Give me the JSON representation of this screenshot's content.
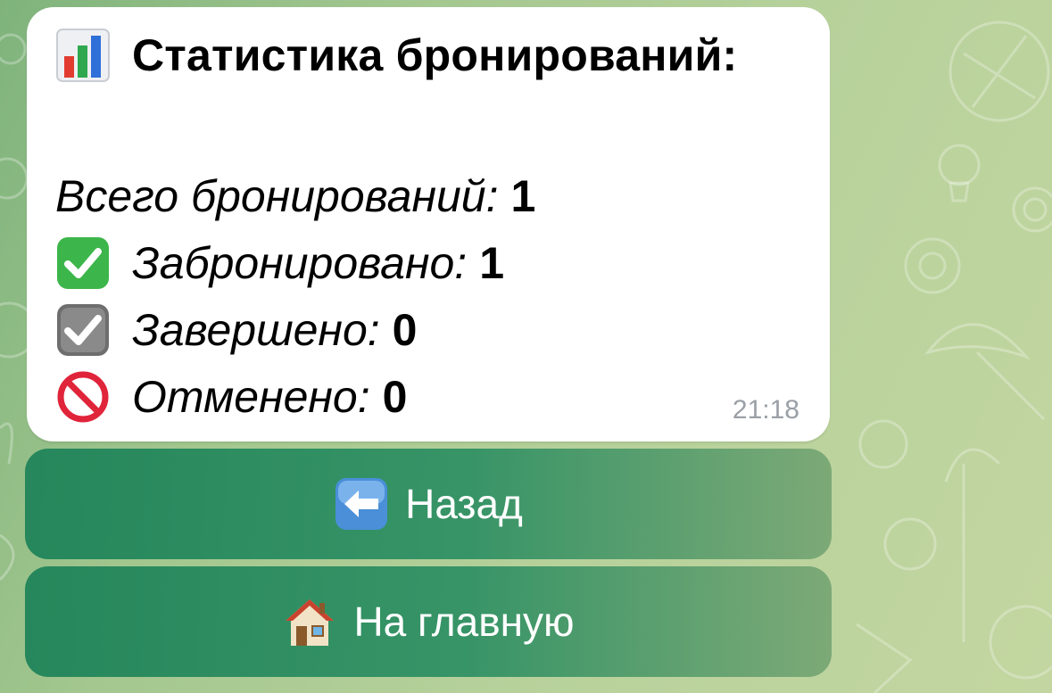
{
  "message": {
    "title": "Статистика бронирований:",
    "title_icon": "bar-chart-icon",
    "stats": [
      {
        "label": "Всего бронирований:",
        "value": "1",
        "icon": ""
      },
      {
        "label": "Забронировано:",
        "value": "1",
        "icon": "check-mark-button-icon"
      },
      {
        "label": "Завершено:",
        "value": "0",
        "icon": "check-box-icon"
      },
      {
        "label": "Отменено:",
        "value": "0",
        "icon": "prohibited-icon"
      }
    ],
    "time": "21:18"
  },
  "keyboard": {
    "back_label": "Назад",
    "back_icon": "left-arrow-icon",
    "home_label": "На главную",
    "home_icon": "house-icon"
  },
  "colors": {
    "bubble": "#ffffff",
    "button": "#1c8258",
    "background": "#a3c78f",
    "check_green": "#3cb64a",
    "check_gray": "#6e6e6e",
    "prohibited_red": "#e0243a"
  }
}
